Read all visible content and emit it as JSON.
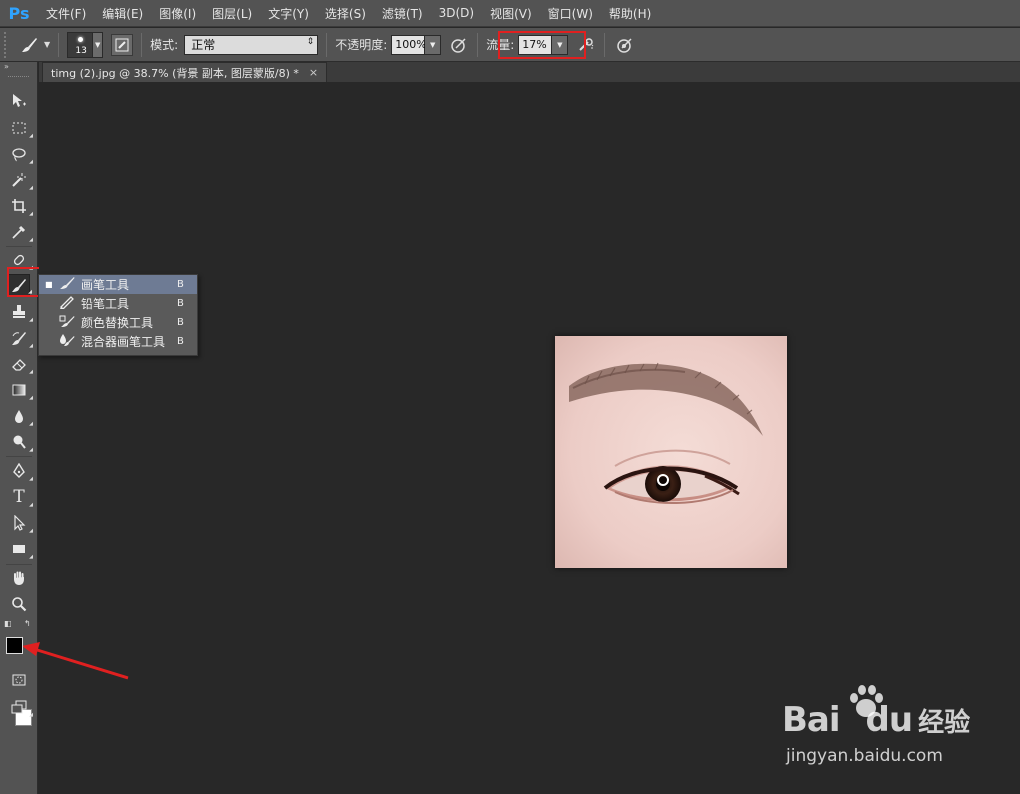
{
  "app": {
    "logo": "Ps",
    "accent": "#2fa3ff"
  },
  "menu": [
    {
      "label": "文件(F)"
    },
    {
      "label": "编辑(E)"
    },
    {
      "label": "图像(I)"
    },
    {
      "label": "图层(L)"
    },
    {
      "label": "文字(Y)"
    },
    {
      "label": "选择(S)"
    },
    {
      "label": "滤镜(T)"
    },
    {
      "label": "3D(D)"
    },
    {
      "label": "视图(V)"
    },
    {
      "label": "窗口(W)"
    },
    {
      "label": "帮助(H)"
    }
  ],
  "options": {
    "brush_size": "13",
    "mode_label": "模式:",
    "mode_value": "正常",
    "opacity_label": "不透明度:",
    "opacity_value": "100%",
    "flow_label": "流量:",
    "flow_value": "17%"
  },
  "document": {
    "tab_title": "timg (2).jpg @ 38.7% (背景 副本, 图层蒙版/8) *",
    "close": "×"
  },
  "flyout": {
    "items": [
      {
        "label": "画笔工具",
        "key": "B",
        "selected": true,
        "icon": "brush-icon"
      },
      {
        "label": "铅笔工具",
        "key": "B",
        "selected": false,
        "icon": "pencil-icon"
      },
      {
        "label": "颜色替换工具",
        "key": "B",
        "selected": false,
        "icon": "color-replacement-icon"
      },
      {
        "label": "混合器画笔工具",
        "key": "B",
        "selected": false,
        "icon": "mixer-brush-icon"
      }
    ]
  },
  "colors": {
    "foreground": "#000000",
    "background": "#ffffff",
    "highlight": "#e02020"
  },
  "watermark": {
    "brand_prefix": "Bai",
    "brand_suffix": "du",
    "product": "经验",
    "url": "jingyan.baidu.com"
  }
}
